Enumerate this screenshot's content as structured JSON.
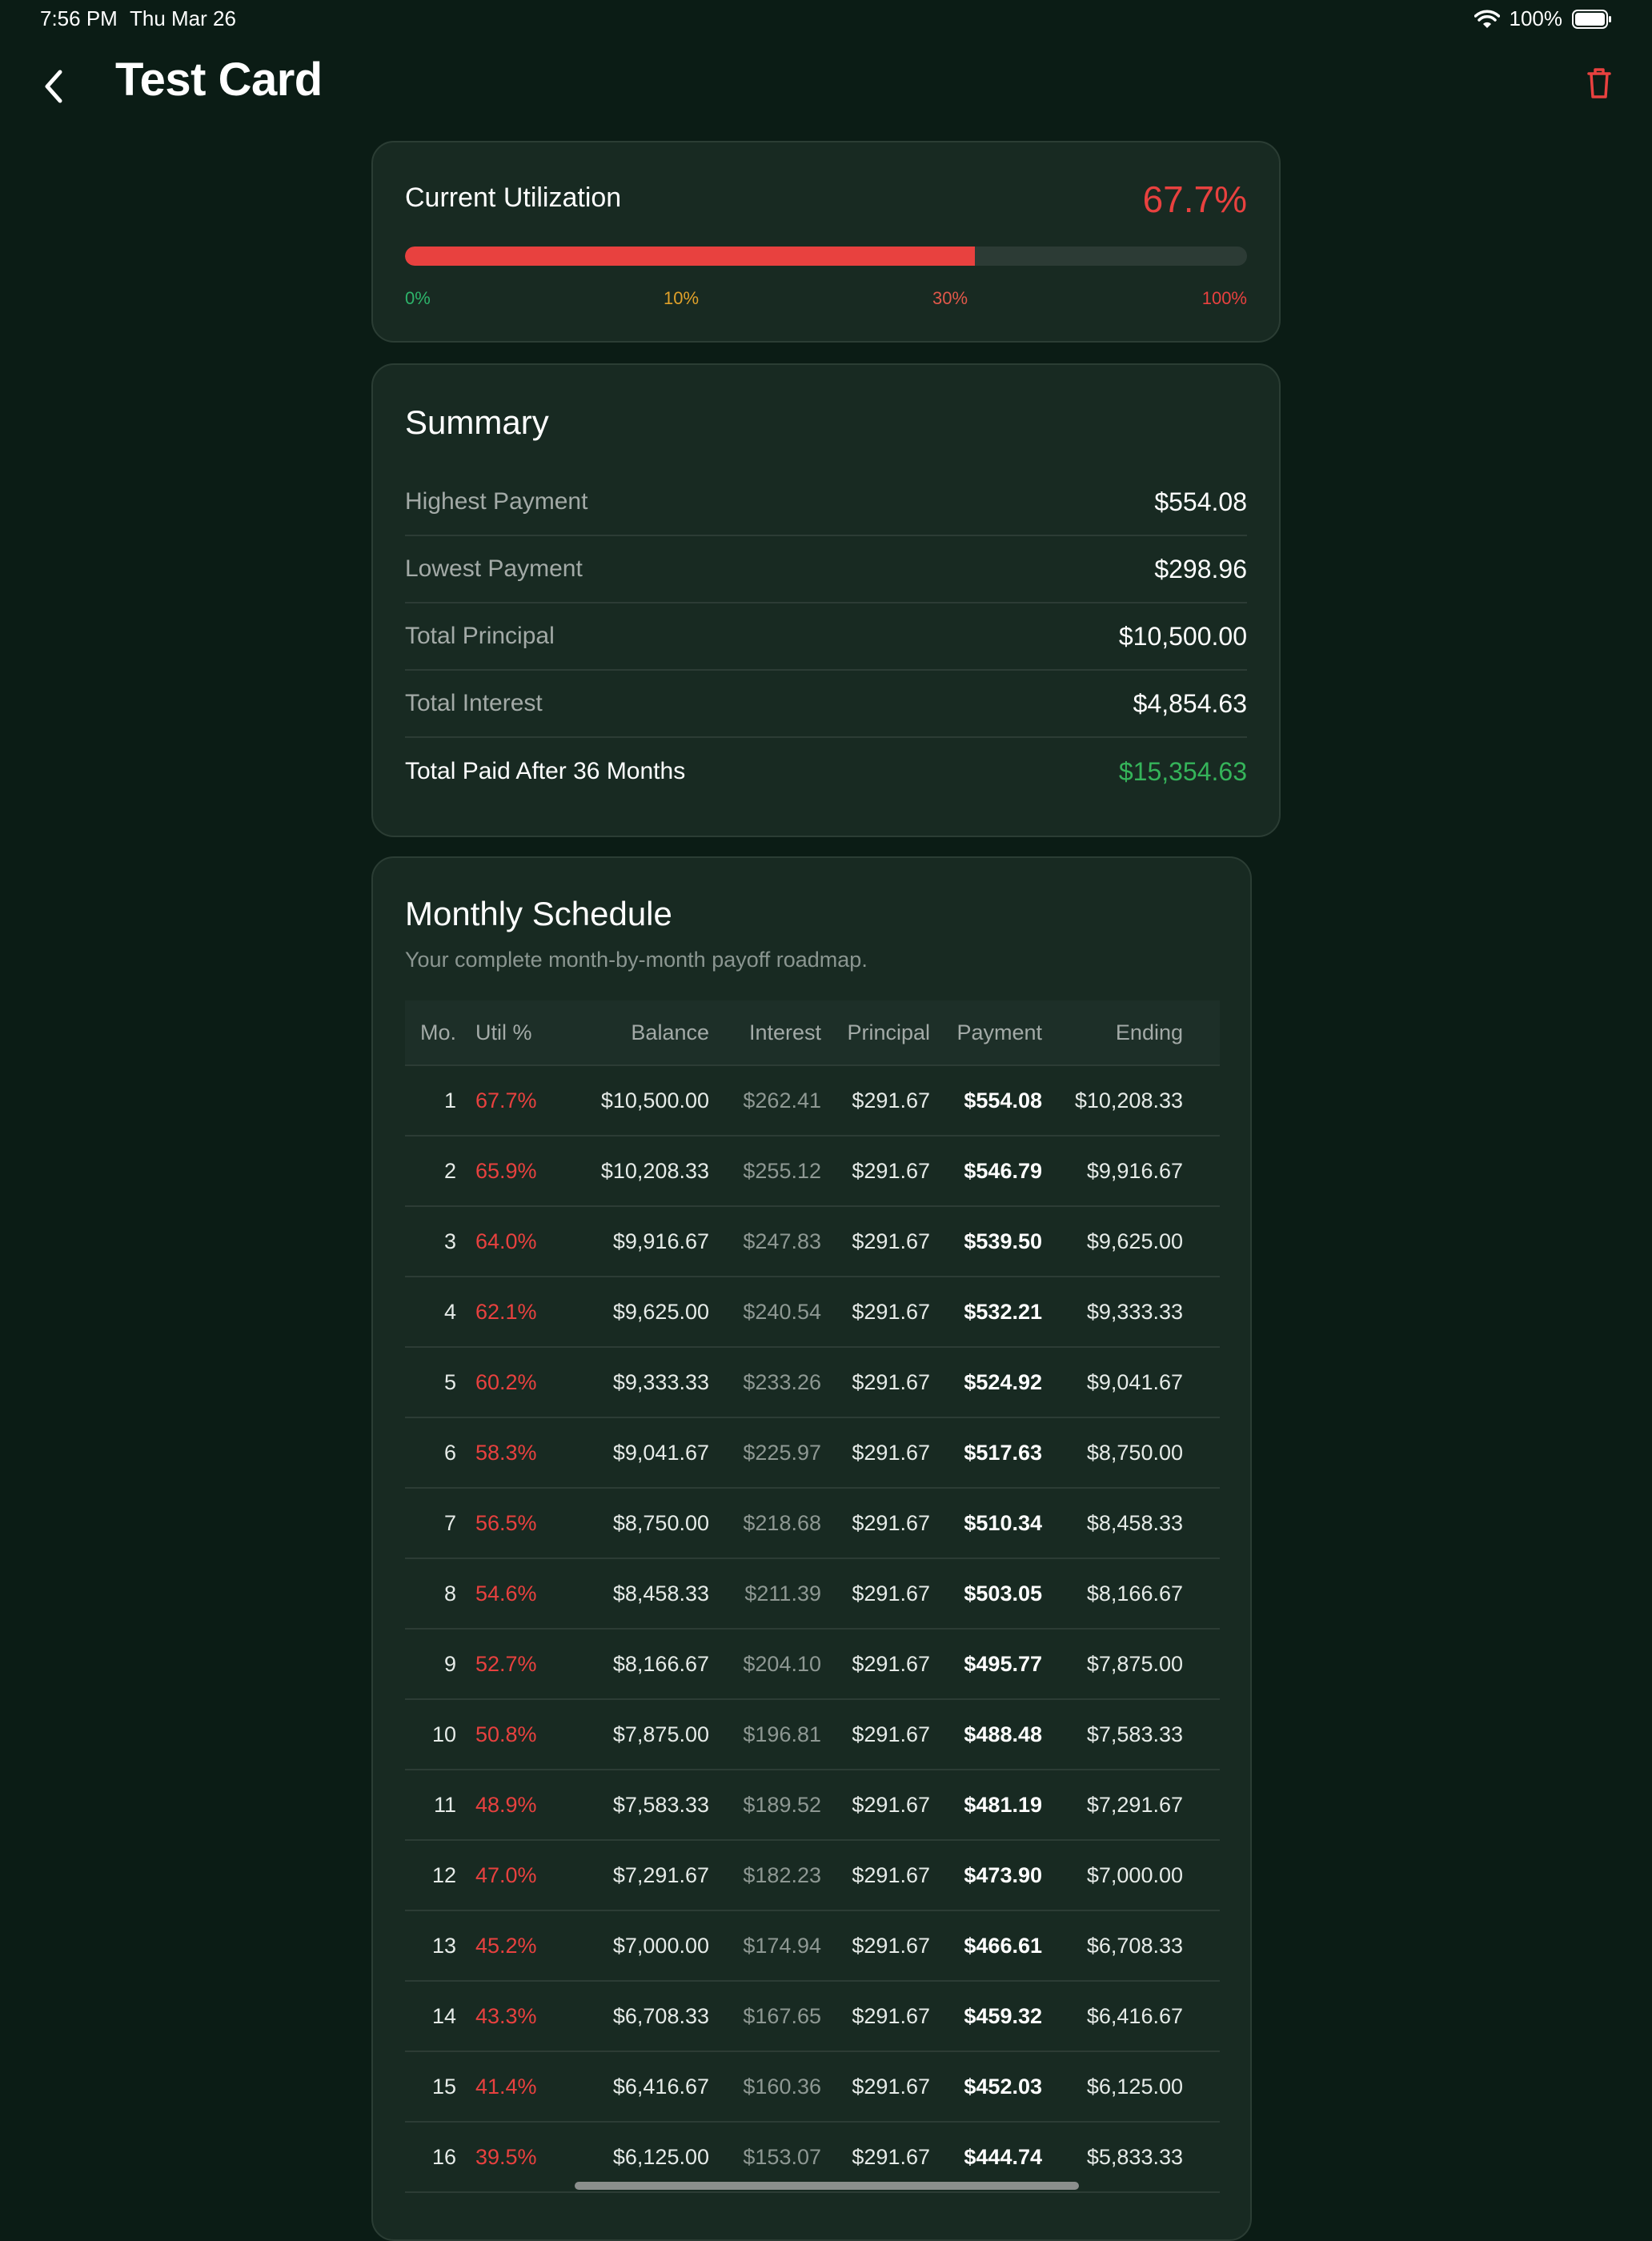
{
  "status_bar": {
    "time": "7:56 PM",
    "date": "Thu Mar 26",
    "battery": "100%"
  },
  "header": {
    "title": "Test Card"
  },
  "utilization": {
    "label": "Current Utilization",
    "value": "67.7%",
    "fraction": 0.677,
    "ticks": [
      {
        "label": "0%",
        "color": "#2db36a"
      },
      {
        "label": "10%",
        "color": "#e0a12a"
      },
      {
        "label": "30%",
        "color": "#e0584a"
      },
      {
        "label": "100%",
        "color": "#e8413f"
      }
    ]
  },
  "summary": {
    "title": "Summary",
    "rows": [
      {
        "label": "Highest Payment",
        "value": "$554.08"
      },
      {
        "label": "Lowest Payment",
        "value": "$298.96"
      },
      {
        "label": "Total Principal",
        "value": "$10,500.00"
      },
      {
        "label": "Total Interest",
        "value": "$4,854.63"
      },
      {
        "label": "Total Paid After 36 Months",
        "value": "$15,354.63"
      }
    ]
  },
  "schedule": {
    "title": "Monthly Schedule",
    "subtitle": "Your complete month-by-month payoff roadmap.",
    "columns": [
      "Mo.",
      "Util %",
      "Balance",
      "Interest",
      "Principal",
      "Payment",
      "Ending"
    ],
    "rows": [
      [
        "1",
        "67.7%",
        "$10,500.00",
        "$262.41",
        "$291.67",
        "$554.08",
        "$10,208.33"
      ],
      [
        "2",
        "65.9%",
        "$10,208.33",
        "$255.12",
        "$291.67",
        "$546.79",
        "$9,916.67"
      ],
      [
        "3",
        "64.0%",
        "$9,916.67",
        "$247.83",
        "$291.67",
        "$539.50",
        "$9,625.00"
      ],
      [
        "4",
        "62.1%",
        "$9,625.00",
        "$240.54",
        "$291.67",
        "$532.21",
        "$9,333.33"
      ],
      [
        "5",
        "60.2%",
        "$9,333.33",
        "$233.26",
        "$291.67",
        "$524.92",
        "$9,041.67"
      ],
      [
        "6",
        "58.3%",
        "$9,041.67",
        "$225.97",
        "$291.67",
        "$517.63",
        "$8,750.00"
      ],
      [
        "7",
        "56.5%",
        "$8,750.00",
        "$218.68",
        "$291.67",
        "$510.34",
        "$8,458.33"
      ],
      [
        "8",
        "54.6%",
        "$8,458.33",
        "$211.39",
        "$291.67",
        "$503.05",
        "$8,166.67"
      ],
      [
        "9",
        "52.7%",
        "$8,166.67",
        "$204.10",
        "$291.67",
        "$495.77",
        "$7,875.00"
      ],
      [
        "10",
        "50.8%",
        "$7,875.00",
        "$196.81",
        "$291.67",
        "$488.48",
        "$7,583.33"
      ],
      [
        "11",
        "48.9%",
        "$7,583.33",
        "$189.52",
        "$291.67",
        "$481.19",
        "$7,291.67"
      ],
      [
        "12",
        "47.0%",
        "$7,291.67",
        "$182.23",
        "$291.67",
        "$473.90",
        "$7,000.00"
      ],
      [
        "13",
        "45.2%",
        "$7,000.00",
        "$174.94",
        "$291.67",
        "$466.61",
        "$6,708.33"
      ],
      [
        "14",
        "43.3%",
        "$6,708.33",
        "$167.65",
        "$291.67",
        "$459.32",
        "$6,416.67"
      ],
      [
        "15",
        "41.4%",
        "$6,416.67",
        "$160.36",
        "$291.67",
        "$452.03",
        "$6,125.00"
      ],
      [
        "16",
        "39.5%",
        "$6,125.00",
        "$153.07",
        "$291.67",
        "$444.74",
        "$5,833.33"
      ]
    ]
  },
  "colors": {
    "background": "#0b1c15",
    "card": "#182a22",
    "accent_red": "#e8413f",
    "accent_green": "#35b45a"
  },
  "icons": {
    "back": "chevron-left-icon",
    "delete": "trash-icon"
  }
}
